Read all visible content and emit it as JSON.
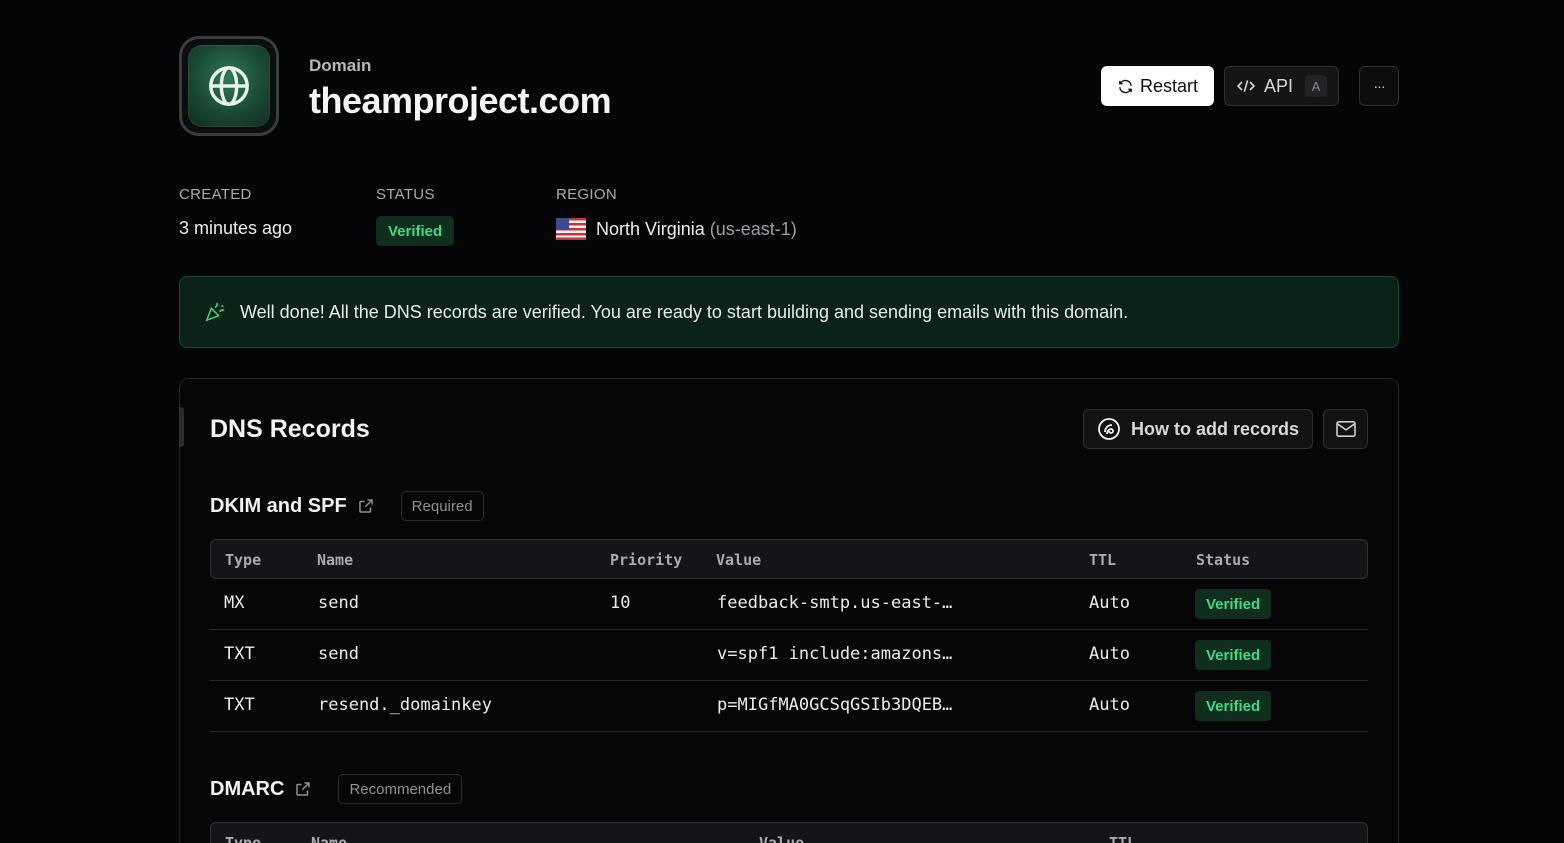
{
  "header": {
    "eyebrow": "Domain",
    "title": "theamproject.com",
    "icon": "globe-icon",
    "restart_label": "Restart",
    "api_label": "API",
    "api_shortcut": "A",
    "more_label": "···"
  },
  "meta": {
    "created_label": "CREATED",
    "created_value": "3 minutes ago",
    "status_label": "STATUS",
    "status_value": "Verified",
    "region_label": "REGION",
    "region_name": "North Virginia",
    "region_code": "(us-east-1)"
  },
  "banner": {
    "text": "Well done! All the DNS records are verified. You are ready to start building and sending emails with this domain."
  },
  "dns": {
    "title": "DNS Records",
    "howto_label": "How to add records",
    "dkim": {
      "title": "DKIM and SPF",
      "tag": "Required",
      "columns": [
        "Type",
        "Name",
        "Priority",
        "Value",
        "TTL",
        "Status"
      ],
      "rows": [
        {
          "type": "MX",
          "name": "send",
          "priority": "10",
          "value": "feedback-smtp.us-east-…",
          "ttl": "Auto",
          "status": "Verified"
        },
        {
          "type": "TXT",
          "name": "send",
          "priority": "",
          "value": "v=spf1 include:amazons…",
          "ttl": "Auto",
          "status": "Verified"
        },
        {
          "type": "TXT",
          "name": "resend._domainkey",
          "priority": "",
          "value": "p=MIGfMA0GCSqGSIb3DQEB…",
          "ttl": "Auto",
          "status": "Verified"
        }
      ]
    },
    "dmarc": {
      "title": "DMARC",
      "tag": "Recommended",
      "columns": [
        "Type",
        "Name",
        "Value",
        "TTL"
      ]
    }
  },
  "colors": {
    "accent_green": "#3ddc84",
    "background": "#050507"
  }
}
